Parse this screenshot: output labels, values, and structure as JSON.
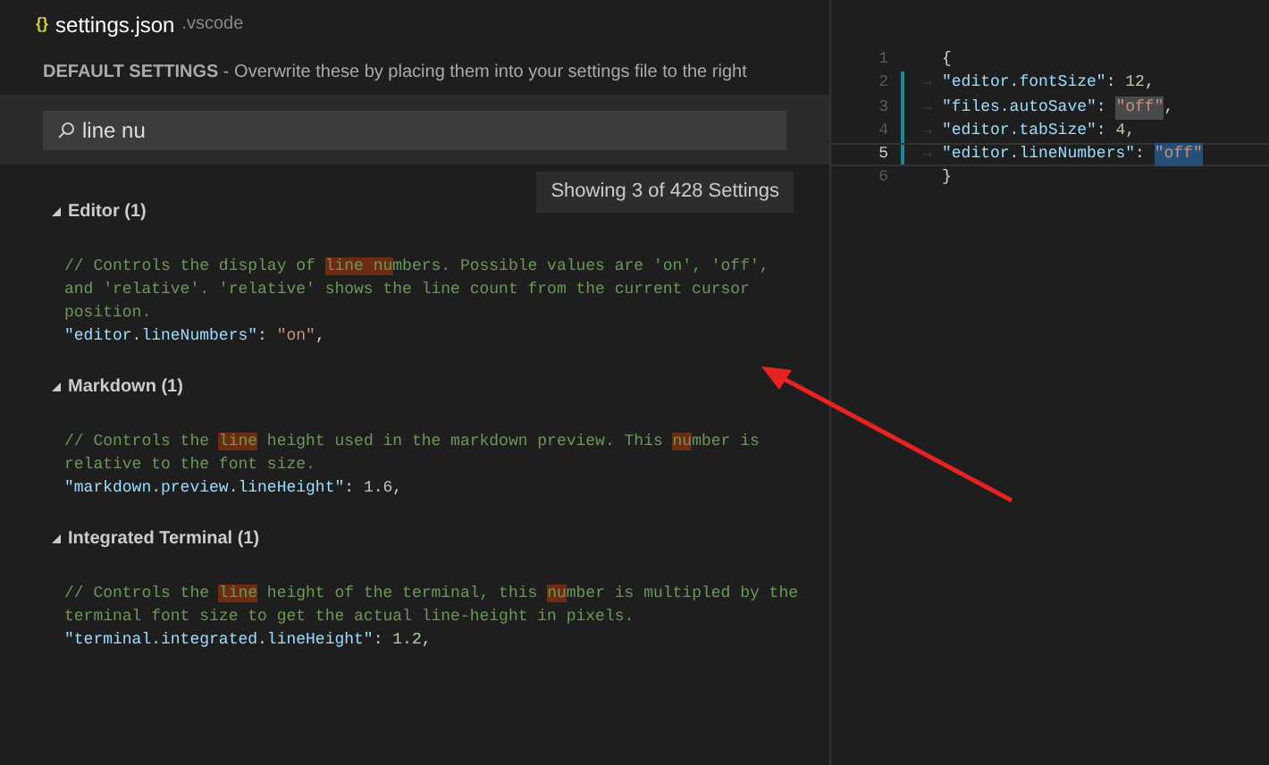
{
  "file_tab": {
    "icon_glyph": "{}",
    "name": "settings.json",
    "folder": ".vscode"
  },
  "banner": {
    "heading": "DEFAULT SETTINGS",
    "text": " - Overwrite these by placing them into your settings file to the right"
  },
  "search": {
    "value": "line nu"
  },
  "result_count": "Showing 3 of 428 Settings",
  "groups": [
    {
      "title": "Editor (1)",
      "expanded": true,
      "comment_lines": [
        [
          {
            "text": "// Controls the display of ",
            "highlighted": false
          },
          {
            "text": "line nu",
            "highlighted": true
          },
          {
            "text": "mbers. Possible values are 'on', 'off',",
            "highlighted": false
          }
        ],
        [
          {
            "text": "and 'relative'. 'relative' shows the line count from the current cursor",
            "highlighted": false
          }
        ],
        [
          {
            "text": "position.",
            "highlighted": false
          }
        ]
      ],
      "tokens": [
        {
          "kind": "key",
          "text": "\"editor.lineNumbers\""
        },
        {
          "kind": "punct",
          "text": ": "
        },
        {
          "kind": "string",
          "text": "\"on\""
        },
        {
          "kind": "punct",
          "text": ","
        }
      ]
    },
    {
      "title": "Markdown (1)",
      "expanded": true,
      "comment_lines": [
        [
          {
            "text": "// Controls the ",
            "highlighted": false
          },
          {
            "text": "line",
            "highlighted": true
          },
          {
            "text": " height used in the markdown preview. This ",
            "highlighted": false
          },
          {
            "text": "nu",
            "highlighted": true
          },
          {
            "text": "mber is",
            "highlighted": false
          }
        ],
        [
          {
            "text": "relative to the font size.",
            "highlighted": false
          }
        ]
      ],
      "tokens": [
        {
          "kind": "key",
          "text": "\"markdown.preview.lineHeight\""
        },
        {
          "kind": "punct",
          "text": ": "
        },
        {
          "kind": "number",
          "text": "1.6"
        },
        {
          "kind": "punct",
          "text": ","
        }
      ]
    },
    {
      "title": "Integrated Terminal (1)",
      "expanded": true,
      "comment_lines": [
        [
          {
            "text": "// Controls the ",
            "highlighted": false
          },
          {
            "text": "line",
            "highlighted": true
          },
          {
            "text": " height of the terminal, this ",
            "highlighted": false
          },
          {
            "text": "nu",
            "highlighted": true
          },
          {
            "text": "mber is multipled by the",
            "highlighted": false
          }
        ],
        [
          {
            "text": "terminal font size to get the actual line-height in pixels.",
            "highlighted": false
          }
        ]
      ],
      "tokens": [
        {
          "kind": "key",
          "text": "\"terminal.integrated.lineHeight\""
        },
        {
          "kind": "punct",
          "text": ": "
        },
        {
          "kind": "number",
          "text": "1.2"
        },
        {
          "kind": "punct",
          "text": ","
        }
      ]
    }
  ],
  "editor_lines": [
    {
      "number": "1",
      "modified": false,
      "current": false,
      "tokens": [
        {
          "kind": "punct",
          "text": "{",
          "highlighted": false,
          "selected": false
        }
      ]
    },
    {
      "number": "2",
      "modified": true,
      "current": false,
      "indent": "→",
      "tokens": [
        {
          "kind": "key",
          "text": "\"editor.fontSize\"",
          "highlighted": false,
          "selected": false
        },
        {
          "kind": "punct",
          "text": ": ",
          "highlighted": false,
          "selected": false
        },
        {
          "kind": "number",
          "text": "12",
          "highlighted": false,
          "selected": false
        },
        {
          "kind": "punct",
          "text": ",",
          "highlighted": false,
          "selected": false
        }
      ]
    },
    {
      "number": "3",
      "modified": true,
      "current": false,
      "indent": "→",
      "tokens": [
        {
          "kind": "key",
          "text": "\"files.autoSave\"",
          "highlighted": false,
          "selected": false
        },
        {
          "kind": "punct",
          "text": ": ",
          "highlighted": false,
          "selected": false
        },
        {
          "kind": "string",
          "text": "\"off\"",
          "highlighted": true,
          "selected": false
        },
        {
          "kind": "punct",
          "text": ",",
          "highlighted": false,
          "selected": false
        }
      ]
    },
    {
      "number": "4",
      "modified": true,
      "current": false,
      "indent": "→",
      "tokens": [
        {
          "kind": "key",
          "text": "\"editor.tabSize\"",
          "highlighted": false,
          "selected": false
        },
        {
          "kind": "punct",
          "text": ": ",
          "highlighted": false,
          "selected": false
        },
        {
          "kind": "number",
          "text": "4",
          "highlighted": false,
          "selected": false
        },
        {
          "kind": "punct",
          "text": ",",
          "highlighted": false,
          "selected": false
        }
      ]
    },
    {
      "number": "5",
      "modified": true,
      "current": true,
      "indent": "→",
      "tokens": [
        {
          "kind": "key",
          "text": "\"editor.lineNumbers\"",
          "highlighted": false,
          "selected": false
        },
        {
          "kind": "punct",
          "text": ": ",
          "highlighted": false,
          "selected": false
        },
        {
          "kind": "string",
          "text": "\"off\"",
          "highlighted": false,
          "selected": true
        }
      ]
    },
    {
      "number": "6",
      "modified": false,
      "current": false,
      "tokens": [
        {
          "kind": "punct",
          "text": "}",
          "highlighted": false,
          "selected": false
        }
      ]
    }
  ]
}
